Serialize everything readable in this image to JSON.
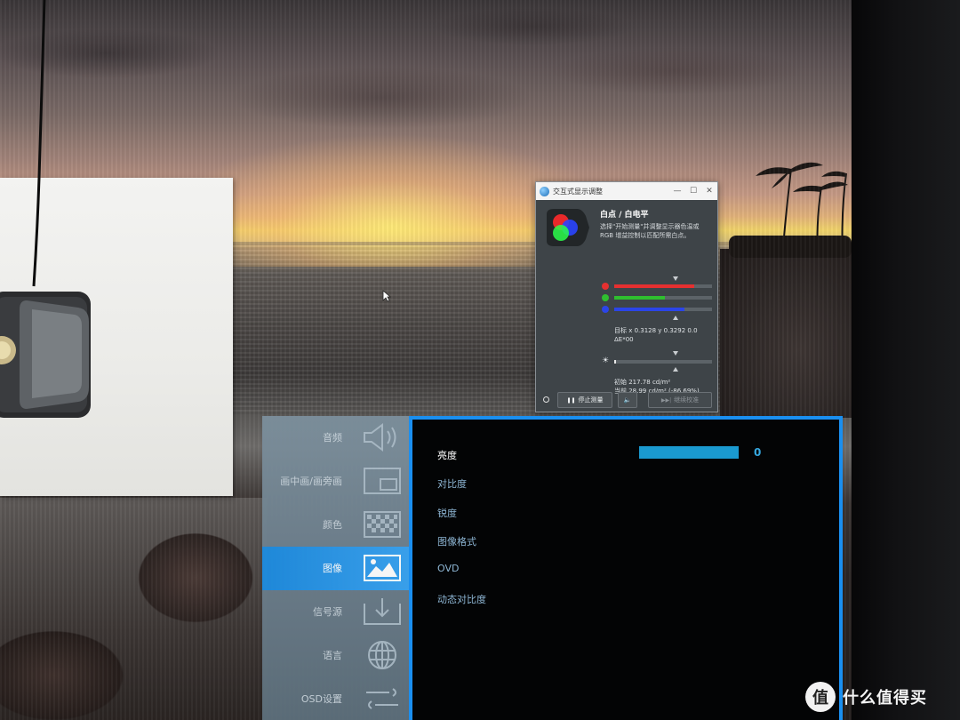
{
  "calibration_window": {
    "title": "交互式显示调整",
    "window_controls": [
      "—",
      "☐",
      "✕"
    ],
    "heading": "白点 / 白电平",
    "description": "选择\"开始测量\"并调整显示器色温或 RGB 增益控制以匹配所需白点。",
    "channels": [
      {
        "name": "red",
        "color": "#e53030",
        "level": 0.82
      },
      {
        "name": "green",
        "color": "#2fbf2f",
        "level": 0.52
      },
      {
        "name": "blue",
        "color": "#2b45e8",
        "level": 0.72
      }
    ],
    "target_text": "目标 x 0.3128 y 0.3292 0.0",
    "delta_text": "ΔE*00",
    "sun_icon": "☀",
    "luminance_level": 0.02,
    "initial_text": "初始 217.78 cd/m²",
    "current_text": "当前 28.99 cd/m² (-86.69%)",
    "stop_button": "停止测量",
    "stop_icon": "❚❚",
    "sound_icon": "🔈",
    "continue_button": "继续校准",
    "continue_icon": "▶▶|"
  },
  "osd": {
    "menu": [
      {
        "label": "音频",
        "icon": "speaker-icon"
      },
      {
        "label": "画中画/画旁画",
        "icon": "pip-icon"
      },
      {
        "label": "颜色",
        "icon": "color-grid-icon"
      },
      {
        "label": "图像",
        "icon": "picture-icon",
        "active": true
      },
      {
        "label": "信号源",
        "icon": "input-source-icon"
      },
      {
        "label": "语言",
        "icon": "globe-icon"
      },
      {
        "label": "OSD设置",
        "icon": "wrench-icon"
      }
    ],
    "settings": [
      "亮度",
      "对比度",
      "锐度",
      "图像格式",
      "OVD",
      "动态对比度"
    ],
    "brightness_value": "0",
    "accent_color": "#1a8ff0"
  },
  "watermark": {
    "logo_char": "值",
    "text": "什么值得买"
  }
}
